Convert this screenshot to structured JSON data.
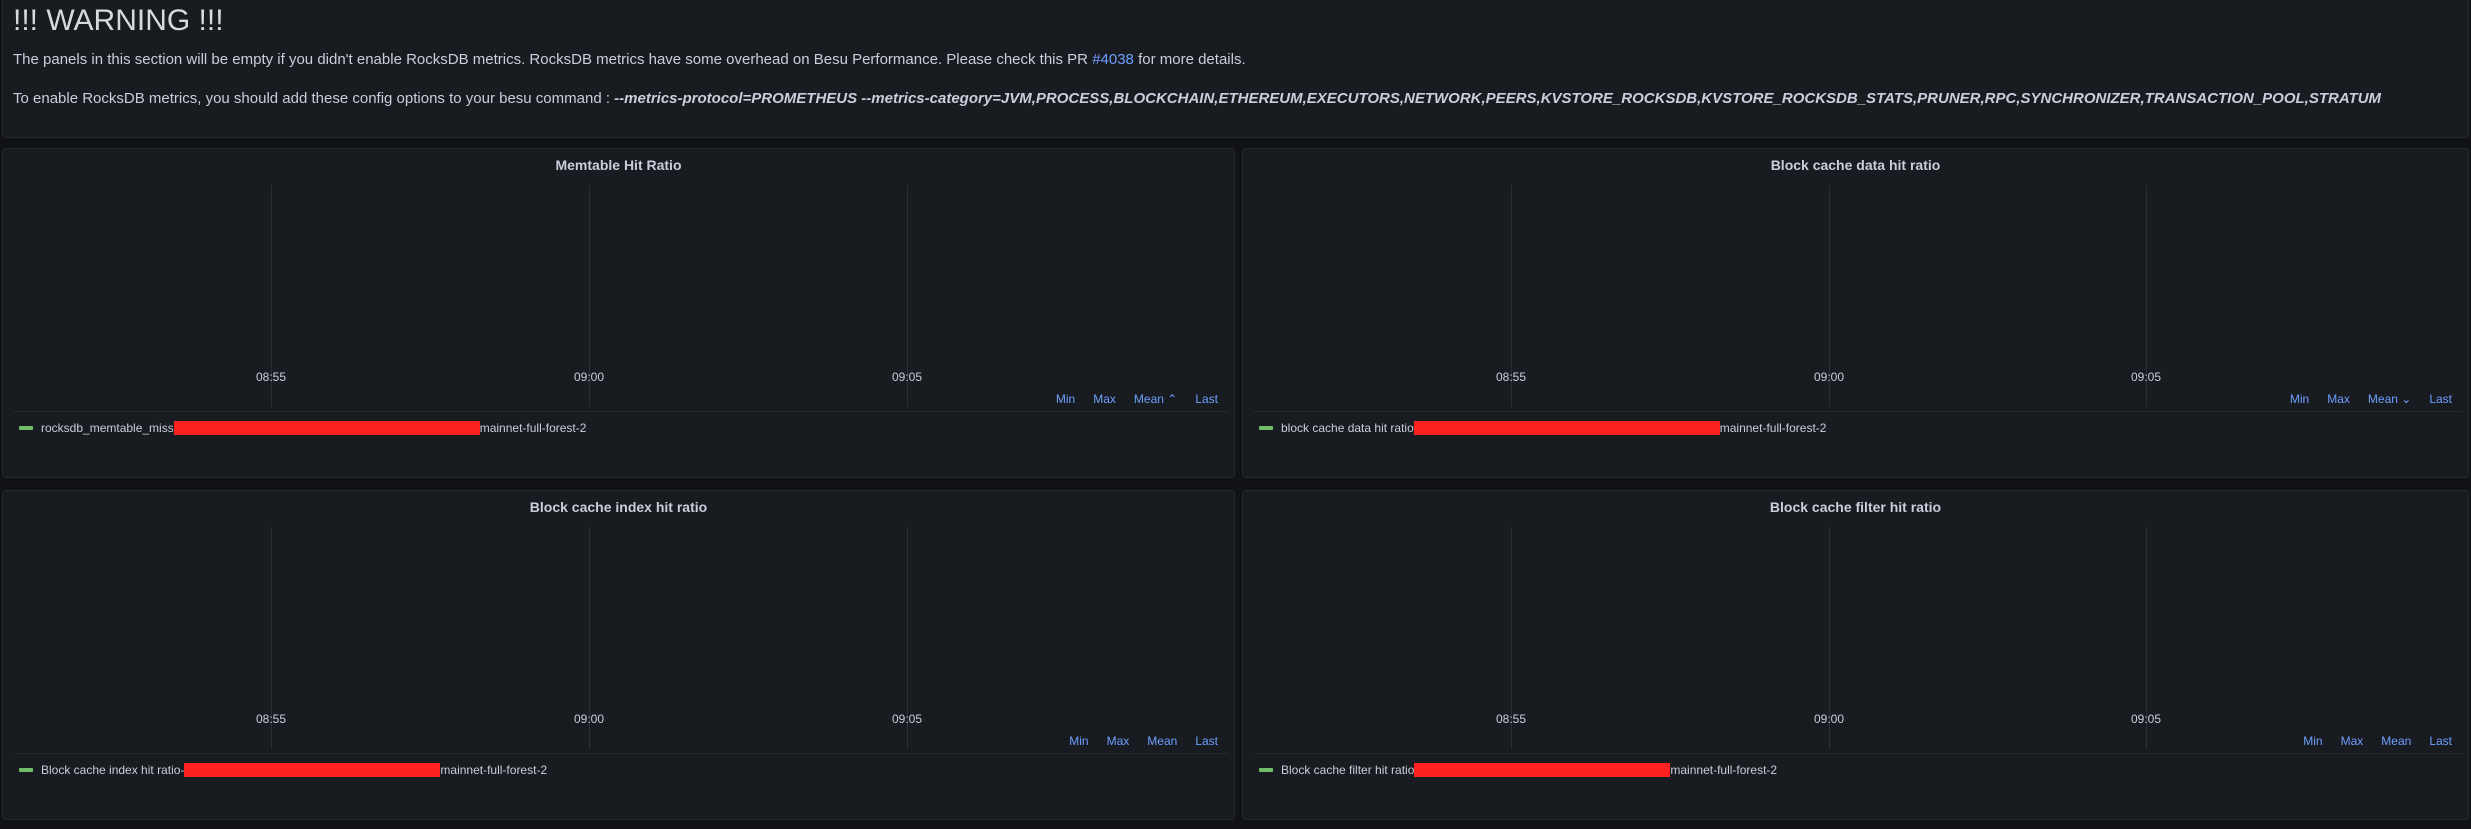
{
  "warning": {
    "title": "!!! WARNING !!!",
    "line1_pre": "The panels in this section will be empty if you didn't enable RocksDB metrics. RocksDB metrics have some overhead on Besu Performance. Please check this PR ",
    "line1_link": "#4038",
    "line1_post": " for more details.",
    "line2_pre": "To enable RocksDB metrics, you should add these config options to your besu command : ",
    "line2_cmd": "--metrics-protocol=PROMETHEUS --metrics-category=JVM,PROCESS,BLOCKCHAIN,ETHEREUM,EXECUTORS,NETWORK,PEERS,KVSTORE_ROCKSDB,KVSTORE_ROCKSDB_STATS,PRUNER,RPC,SYNCHRONIZER,TRANSACTION_POOL,STRATUM"
  },
  "panels": [
    {
      "title": "Memtable Hit Ratio",
      "x_ticks": [
        "08:55",
        "09:00",
        "09:05"
      ],
      "legend_headers": [
        "Min",
        "Max",
        "Mean ⌃",
        "Last"
      ],
      "series": {
        "label_pre": "rocksdb_memtable_miss",
        "label_post": "mainnet-full-forest-2"
      }
    },
    {
      "title": "Block cache data hit ratio",
      "x_ticks": [
        "08:55",
        "09:00",
        "09:05"
      ],
      "legend_headers": [
        "Min",
        "Max",
        "Mean ⌄",
        "Last"
      ],
      "series": {
        "label_pre": "block cache data hit ratio ",
        "label_post": "mainnet-full-forest-2"
      }
    },
    {
      "title": "Block cache index hit ratio",
      "x_ticks": [
        "08:55",
        "09:00",
        "09:05"
      ],
      "legend_headers": [
        "Min",
        "Max",
        "Mean",
        "Last"
      ],
      "series": {
        "label_pre": "Block cache index hit ratio-",
        "label_post": "mainnet-full-forest-2"
      }
    },
    {
      "title": "Block cache filter hit ratio",
      "x_ticks": [
        "08:55",
        "09:00",
        "09:05"
      ],
      "legend_headers": [
        "Min",
        "Max",
        "Mean",
        "Last"
      ],
      "series": {
        "label_pre": "Block cache filter hit ratio ",
        "label_post": "mainnet-full-forest-2"
      }
    }
  ],
  "colors": {
    "series": "#73bf69",
    "link": "#6e9fff",
    "redaction": "#ff2020"
  }
}
